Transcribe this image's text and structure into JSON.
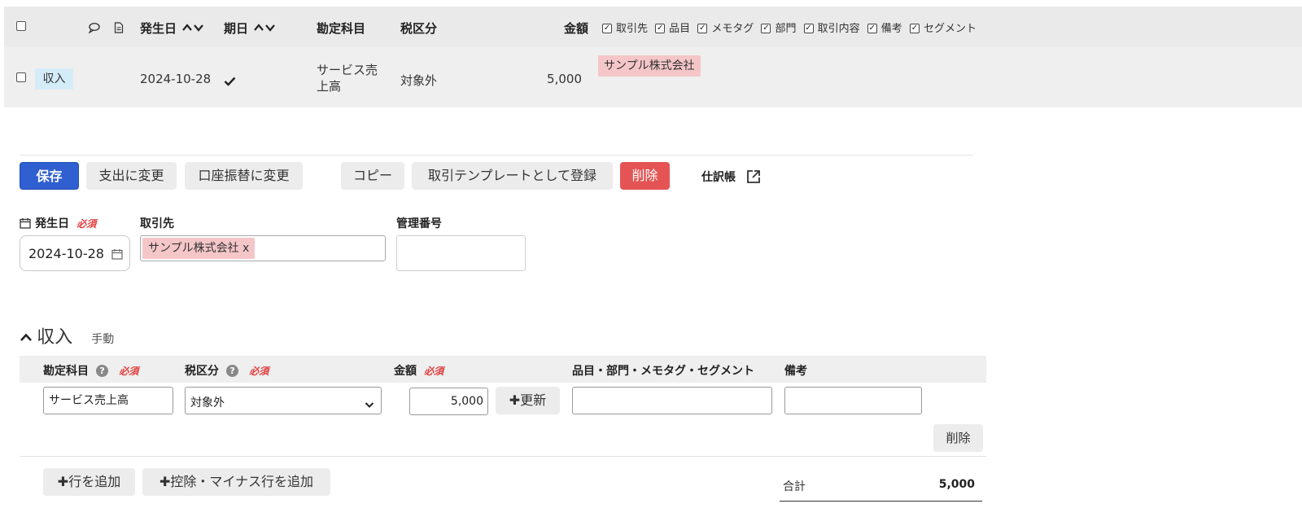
{
  "list": {
    "header": {
      "date": "発生日",
      "due": "期日",
      "account": "勘定科目",
      "tax": "税区分",
      "amount": "金額",
      "col_toggles": [
        "取引先",
        "品目",
        "メモタグ",
        "部門",
        "取引内容",
        "備考",
        "セグメント"
      ]
    },
    "row": {
      "type": "収入",
      "date": "2024-10-28",
      "account": "サービス売上高",
      "tax": "対象外",
      "amount": "5,000",
      "partner": "サンプル株式会社"
    }
  },
  "toolbar": {
    "save": "保存",
    "to_expense": "支出に変更",
    "to_transfer": "口座振替に変更",
    "copy": "コピー",
    "register_template": "取引テンプレートとして登録",
    "delete": "削除",
    "journal": "仕訳帳"
  },
  "form": {
    "date_label": "発生日",
    "required": "必須",
    "date_value": "2024-10-28",
    "partner_label": "取引先",
    "partner_value": "サンプル株式会社 x",
    "ref_label": "管理番号",
    "ref_value": ""
  },
  "section": {
    "title": "収入",
    "mode": "手動"
  },
  "detail": {
    "headers": {
      "account": "勘定科目",
      "tax": "税区分",
      "amount": "金額",
      "tags": "品目・部門・メモタグ・セグメント",
      "note": "備考"
    },
    "row": {
      "account": "サービス売上高",
      "tax": "対象外",
      "amount": "5,000",
      "update": "更新",
      "tags": "",
      "note": "",
      "delete": "削除"
    },
    "add_row": "行を追加",
    "add_minus_row": "控除・マイナス行を追加",
    "total_label": "合計",
    "total_value": "5,000"
  },
  "colors": {
    "primary": "#2f5fd0",
    "danger": "#e45454",
    "partner_tag": "#f5c6c8",
    "type_badge": "#d4ecf8"
  }
}
